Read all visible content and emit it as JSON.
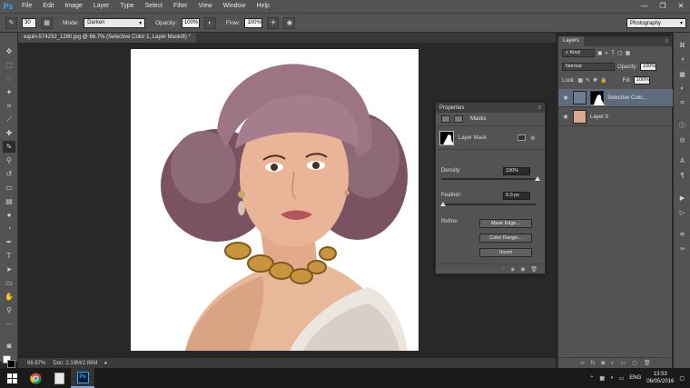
{
  "app": {
    "logo": "Ps",
    "menu": [
      "File",
      "Edit",
      "Image",
      "Layer",
      "Type",
      "Select",
      "Filter",
      "View",
      "Window",
      "Help"
    ],
    "window_controls": [
      "—",
      "❐",
      "✕"
    ]
  },
  "options_bar": {
    "brush_size": "30",
    "mode_label": "Mode:",
    "mode_value": "Darken",
    "opacity_label": "Opacity:",
    "opacity_value": "100%",
    "flow_label": "Flow:",
    "flow_value": "100%",
    "workspace": "Photography"
  },
  "document": {
    "tab_title": "equin-574232_1280.jpg @ 66.7% (Selective Color 1, Layer Mask/8) *",
    "status": "Doc: 2.19M/2.88M",
    "zoom": "66.67%"
  },
  "properties": {
    "tab": "Properties",
    "section": "Masks",
    "layer_mask_label": "Layer Mask",
    "density_label": "Density:",
    "density_value": "100%",
    "density_level": 1.0,
    "feather_label": "Feather:",
    "feather_value": "0.0 px",
    "feather_level": 0.0,
    "refine_label": "Refine:",
    "mask_edge_btn": "Mask Edge...",
    "color_range_btn": "Color Range...",
    "invert_btn": "Invert"
  },
  "layers": {
    "tab": "Layers",
    "kind_label": "Kind",
    "blend_mode": "Normal",
    "opacity_label": "Opacity:",
    "opacity_value": "100%",
    "lock_label": "Lock:",
    "fill_label": "Fill:",
    "fill_value": "100%",
    "items": [
      {
        "name": "Selective Colo...",
        "selected": true
      },
      {
        "name": "Layer 0",
        "selected": false
      }
    ]
  },
  "taskbar": {
    "language": "ENG",
    "time": "13:53",
    "date": "06/05/2016",
    "ps_label": "Ps"
  },
  "colors": {
    "panel": "#535353",
    "canvas_bg": "#282828",
    "accent": "#31a8ff",
    "selected_layer": "#5e6c7d"
  }
}
